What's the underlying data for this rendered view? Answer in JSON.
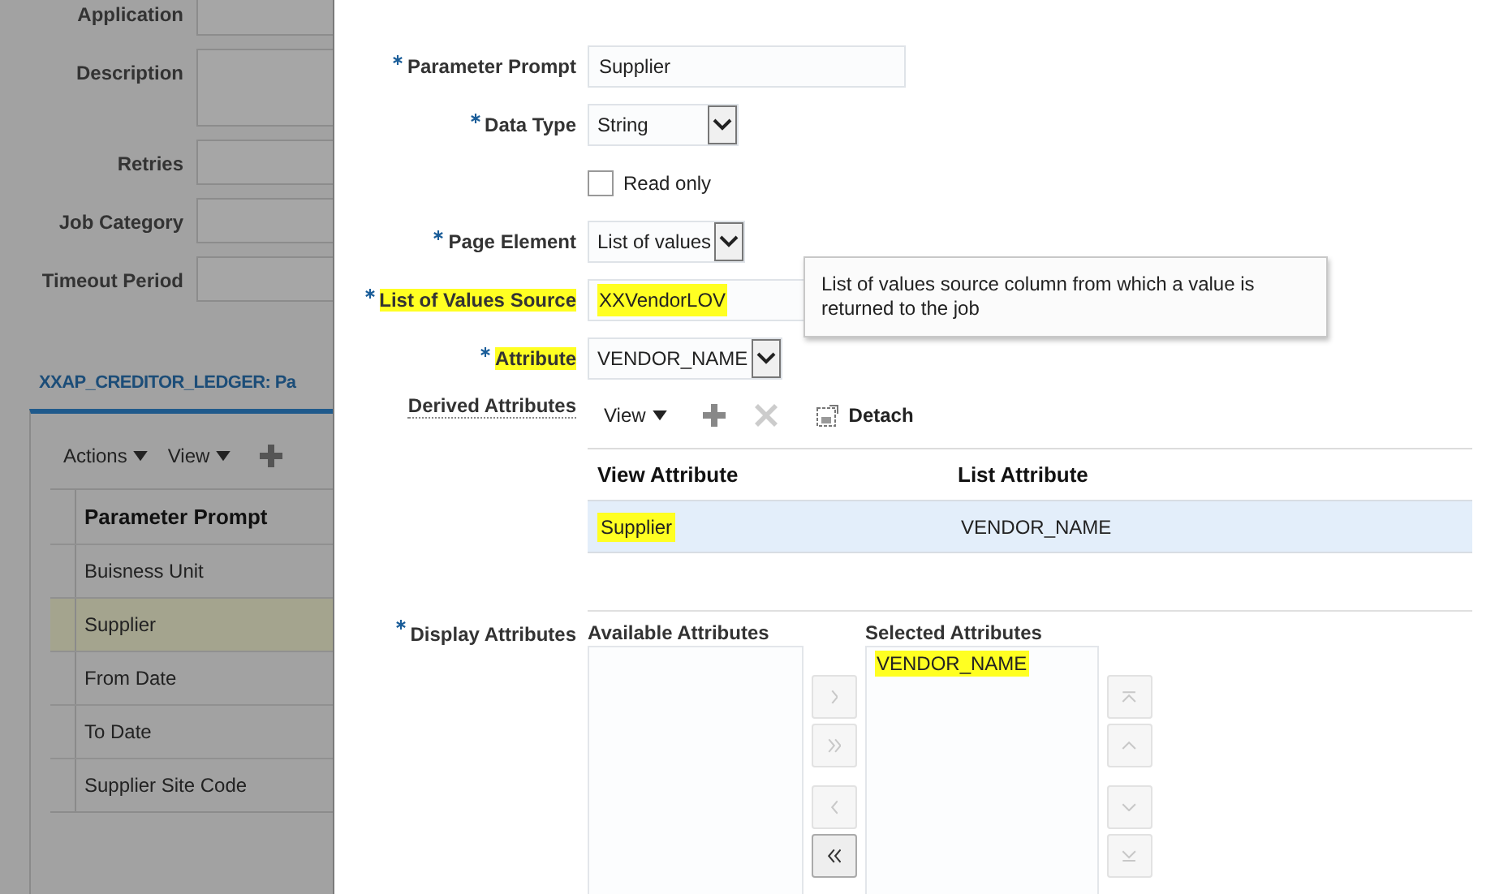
{
  "background_page": {
    "form_fields": [
      {
        "kind": "input",
        "label": "Application"
      },
      {
        "kind": "textarea",
        "label": "Description"
      },
      {
        "kind": "input",
        "label": "Retries"
      },
      {
        "kind": "input",
        "label": "Job Category"
      },
      {
        "kind": "input",
        "label": "Timeout Period"
      }
    ],
    "section_title": "XXAP_CREDITOR_LEDGER: Pa",
    "toolbar": [
      "Actions",
      "View"
    ],
    "table": {
      "columns": [
        "Parameter Prompt"
      ],
      "rows": [
        {
          "cells": [
            "Buisness Unit"
          ],
          "selected": false
        },
        {
          "cells": [
            "Supplier"
          ],
          "selected": true
        },
        {
          "cells": [
            "From Date"
          ],
          "selected": false
        },
        {
          "cells": [
            "To Date"
          ],
          "selected": false
        },
        {
          "cells": [
            "Supplier Site Code"
          ],
          "selected": false
        }
      ]
    }
  },
  "dialog": {
    "fields": [
      {
        "kind": "text",
        "label": "Parameter Prompt",
        "required": true,
        "value": "Supplier",
        "label_highlighted": false,
        "value_highlighted": false
      },
      {
        "kind": "select",
        "label": "Data Type",
        "required": true,
        "value": "String",
        "label_highlighted": false,
        "value_highlighted": false
      },
      {
        "kind": "checkbox",
        "label": "Read only",
        "checked": false
      },
      {
        "kind": "select",
        "label": "Page Element",
        "required": true,
        "value": "List of values",
        "label_highlighted": false,
        "value_highlighted": false
      },
      {
        "kind": "text",
        "label": "List of Values Source",
        "required": true,
        "value": "XXVendorLOV",
        "label_highlighted": true,
        "value_highlighted": true
      },
      {
        "kind": "select",
        "label": "Attribute",
        "required": true,
        "value": "VENDOR_NAME",
        "label_highlighted": true,
        "value_highlighted": false
      }
    ],
    "tooltip": "List of values source column from which a value is returned to the job",
    "derived_attributes": {
      "label": "Derived Attributes",
      "view": "View",
      "detach": "Detach",
      "columns": [
        "View Attribute",
        "List Attribute"
      ],
      "rows": [
        {
          "cells": [
            {
              "text": "Supplier",
              "highlighted": true
            },
            {
              "text": "VENDOR_NAME",
              "highlighted": false
            }
          ],
          "selected": true
        }
      ]
    },
    "display_attributes": {
      "label": "Display Attributes",
      "required": true,
      "available_title": "Available Attributes",
      "selected_title": "Selected Attributes",
      "selected_items": [
        {
          "text": "VENDOR_NAME",
          "highlighted": true
        }
      ],
      "move_buttons": [
        {
          "kind": "right",
          "disabled": true
        },
        {
          "kind": "all-right",
          "disabled": true
        },
        {
          "kind": "left",
          "disabled": true
        },
        {
          "kind": "all-left",
          "disabled": false
        }
      ],
      "order_buttons": [
        {
          "kind": "top",
          "disabled": true
        },
        {
          "kind": "up",
          "disabled": true
        },
        {
          "kind": "down",
          "disabled": true
        },
        {
          "kind": "bottom",
          "disabled": true
        }
      ]
    }
  }
}
